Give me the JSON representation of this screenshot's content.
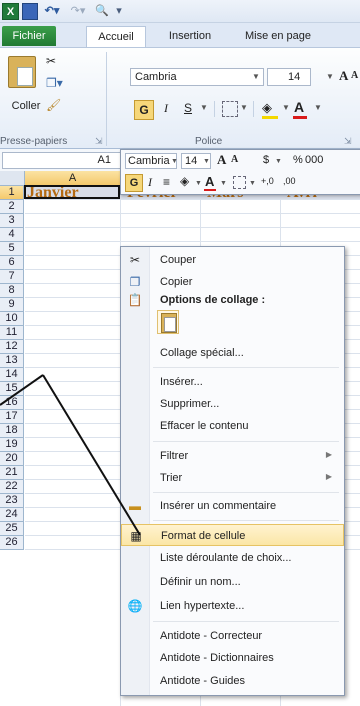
{
  "qat": {
    "icons": [
      "excel-icon",
      "save-icon",
      "undo-icon",
      "redo-icon",
      "print-preview-icon",
      "customize-icon"
    ]
  },
  "tabs": {
    "fichier": "Fichier",
    "accueil": "Accueil",
    "insertion": "Insertion",
    "mise_en_page": "Mise en page"
  },
  "ribbon": {
    "coller": "Coller",
    "presse_papiers": "Presse-papiers",
    "police_label": "Police",
    "font": "Cambria",
    "size": "14",
    "bold": "G",
    "italic": "I",
    "underline": "S",
    "grow": "A",
    "shrink": "A",
    "font_color_letter": "A"
  },
  "formula_bar": {
    "name_box": "A1"
  },
  "mini_toolbar": {
    "font": "Cambria",
    "size": "14",
    "grow": "A",
    "shrink": "A",
    "currency": "$",
    "percent": "%",
    "comma": "000",
    "bold": "G",
    "italic": "I",
    "color_letter": "A",
    "dec_inc": "+,0",
    "dec_dec": ",00"
  },
  "grid": {
    "column_a": "A",
    "rows": [
      "1",
      "2",
      "3",
      "4",
      "5",
      "6",
      "7",
      "8",
      "9",
      "10",
      "11",
      "12",
      "13",
      "14",
      "15",
      "16",
      "17",
      "18",
      "19",
      "20",
      "21",
      "22",
      "23",
      "24",
      "25",
      "26"
    ],
    "row1": [
      "Janvier",
      "Février",
      "Mars",
      "Avri"
    ]
  },
  "context_menu": {
    "couper": "Couper",
    "copier": "Copier",
    "options_collage": "Options de collage :",
    "collage_special": "Collage spécial...",
    "inserer": "Insérer...",
    "supprimer": "Supprimer...",
    "effacer": "Effacer le contenu",
    "filtrer": "Filtrer",
    "trier": "Trier",
    "inserer_commentaire": "Insérer un commentaire",
    "format_cellule": "Format de cellule",
    "liste_deroulante": "Liste déroulante de choix...",
    "definir_nom": "Définir un nom...",
    "lien_hypertexte": "Lien hypertexte...",
    "antidote_correcteur": "Antidote - Correcteur",
    "antidote_dictionnaires": "Antidote - Dictionnaires",
    "antidote_guides": "Antidote - Guides"
  },
  "colors": {
    "accent_selected": "#fbe6a6",
    "header_text": "#b46a12",
    "file_tab": "#217a33"
  }
}
